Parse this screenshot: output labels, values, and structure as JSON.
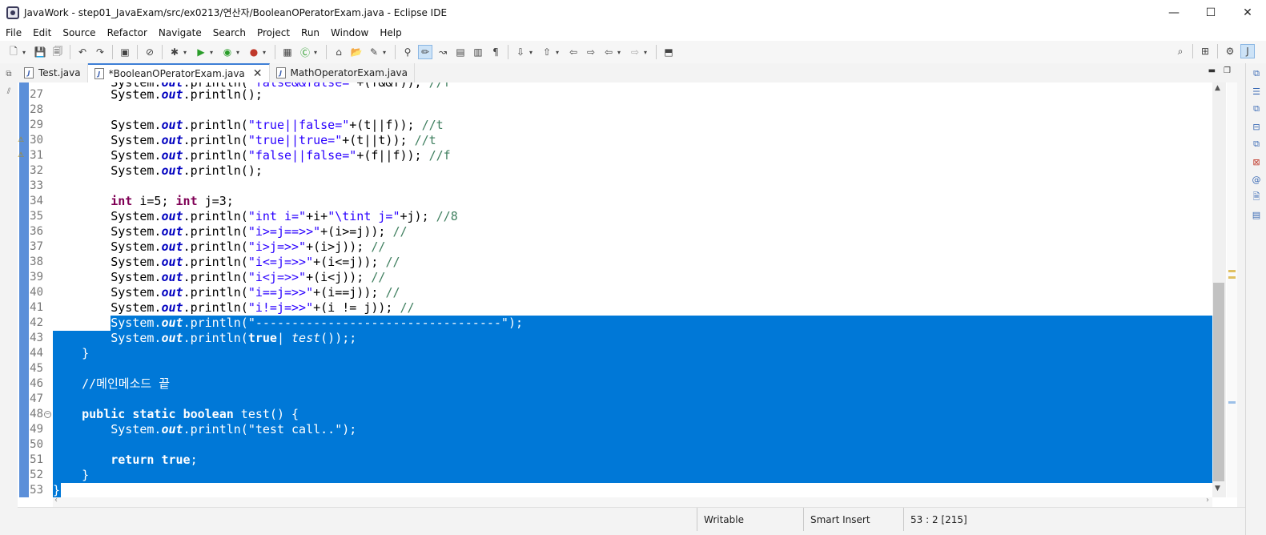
{
  "window": {
    "title": "JavaWork - step01_JavaExam/src/ex0213/연산자/BooleanOPeratorExam.java - Eclipse IDE",
    "controls": [
      "—",
      "☐",
      "✕"
    ]
  },
  "menu": [
    "File",
    "Edit",
    "Source",
    "Refactor",
    "Navigate",
    "Search",
    "Project",
    "Run",
    "Window",
    "Help"
  ],
  "tabs": [
    {
      "label": "Test.java",
      "active": false,
      "dirty": false
    },
    {
      "label": "*BooleanOPeratorExam.java",
      "active": true,
      "dirty": true
    },
    {
      "label": "MathOperatorExam.java",
      "active": false,
      "dirty": false
    }
  ],
  "tab_controls": {
    "minimize": "▬",
    "maximize": "❐"
  },
  "editor": {
    "lines": [
      {
        "n": "27",
        "t": "        System.out.println();"
      },
      {
        "n": "28",
        "t": ""
      },
      {
        "n": "29",
        "t": "        System.out.println(\"true||false=\"+(t||f)); //t"
      },
      {
        "n": "30",
        "t": "        System.out.println(\"true||true=\"+(t||t)); //t"
      },
      {
        "n": "31",
        "t": "        System.out.println(\"false||false=\"+(f||f)); //f"
      },
      {
        "n": "32",
        "t": "        System.out.println();"
      },
      {
        "n": "33",
        "t": ""
      },
      {
        "n": "34",
        "t": "        int i=5; int j=3;"
      },
      {
        "n": "35",
        "t": "        System.out.println(\"int i=\"+i+\"\\tint j=\"+j); //8"
      },
      {
        "n": "36",
        "t": "        System.out.println(\"i>=j==>>\"+(i>=j)); //"
      },
      {
        "n": "37",
        "t": "        System.out.println(\"i>j=>>\"+(i>j)); //"
      },
      {
        "n": "38",
        "t": "        System.out.println(\"i<=j=>>\"+(i<=j)); //"
      },
      {
        "n": "39",
        "t": "        System.out.println(\"i<j=>>\"+(i<j)); //"
      },
      {
        "n": "40",
        "t": "        System.out.println(\"i==j=>>\"+(i==j)); //"
      },
      {
        "n": "41",
        "t": "        System.out.println(\"i!=j=>>\"+(i != j)); //"
      },
      {
        "n": "42",
        "t": "        System.out.println(\"----------------------------------\");"
      },
      {
        "n": "43",
        "t": "        System.out.println(true| test());;"
      },
      {
        "n": "44",
        "t": "    }"
      },
      {
        "n": "45",
        "t": ""
      },
      {
        "n": "46",
        "t": "    //메인메소드 끝"
      },
      {
        "n": "47",
        "t": ""
      },
      {
        "n": "48",
        "t": "    public static boolean test() {"
      },
      {
        "n": "49",
        "t": "        System.out.println(\"test call..\");"
      },
      {
        "n": "50",
        "t": ""
      },
      {
        "n": "51",
        "t": "        return true;"
      },
      {
        "n": "52",
        "t": "    }"
      },
      {
        "n": "53",
        "t": "}"
      }
    ],
    "top_cut_line": "        System.out.println(\"false&&false=\"+(f&&f)); //f",
    "selection": {
      "from_line": "42",
      "to_line": "53"
    },
    "warning_lines": [
      "30",
      "31"
    ],
    "fold_lines": [
      "48"
    ]
  },
  "status": {
    "writable": "Writable",
    "insert_mode": "Smart Insert",
    "position": "53 : 2 [215]"
  },
  "colors": {
    "selection": "#0078d7",
    "keyword": "#7f0055",
    "string": "#2a00ff",
    "comment": "#3f7f5f",
    "field": "#0000c0"
  }
}
